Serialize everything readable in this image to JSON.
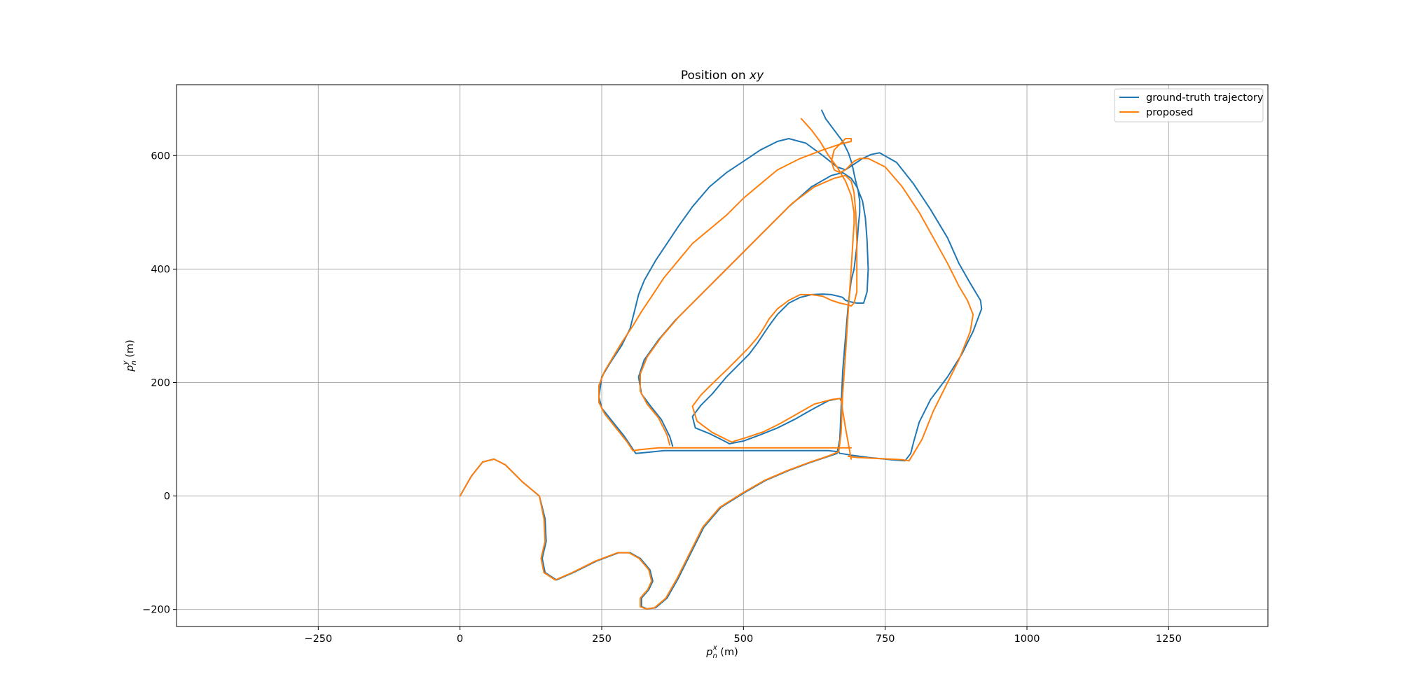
{
  "chart_data": {
    "type": "line",
    "title_prefix": "Position on ",
    "title_var": "xy",
    "xlabel_var": "p",
    "xlabel_sub": "n",
    "xlabel_sup": "x",
    "xlabel_unit": " (m)",
    "ylabel_var": "p",
    "ylabel_sub": "n",
    "ylabel_sup": "y",
    "ylabel_unit": " (m)",
    "xlim": [
      -500,
      1425
    ],
    "ylim": [
      -230,
      725
    ],
    "xticks": [
      -250,
      0,
      250,
      500,
      750,
      1000,
      1250
    ],
    "xtick_labels": [
      "−250",
      "0",
      "250",
      "500",
      "750",
      "1000",
      "1250"
    ],
    "yticks": [
      -200,
      0,
      200,
      400,
      600
    ],
    "ytick_labels": [
      "−200",
      "0",
      "200",
      "400",
      "600"
    ],
    "grid": true,
    "legend_position": "top-right",
    "series": [
      {
        "name": "ground-truth trajectory",
        "color": "#1f77b4",
        "x": [
          0,
          20,
          40,
          60,
          80,
          110,
          140,
          150,
          152,
          145,
          150,
          170,
          200,
          240,
          280,
          300,
          318,
          335,
          340,
          333,
          320,
          320,
          330,
          345,
          365,
          385,
          410,
          430,
          460,
          500,
          540,
          580,
          620,
          650,
          665,
          670,
          672,
          675,
          680,
          685,
          690,
          695,
          700,
          703,
          705,
          705,
          702,
          698,
          695,
          693,
          690,
          685,
          675,
          660,
          645,
          638,
          638
        ],
        "y": [
          0,
          35,
          60,
          65,
          55,
          25,
          0,
          -40,
          -80,
          -110,
          -135,
          -148,
          -135,
          -115,
          -100,
          -100,
          -110,
          -130,
          -150,
          -165,
          -180,
          -195,
          -199,
          -197,
          -180,
          -145,
          -95,
          -55,
          -20,
          5,
          28,
          45,
          60,
          70,
          75,
          100,
          150,
          220,
          280,
          340,
          380,
          400,
          440,
          480,
          500,
          520,
          540,
          555,
          568,
          578,
          590,
          605,
          625,
          645,
          665,
          680,
          680
        ]
      },
      {
        "name": "",
        "color": "#1f77b4",
        "x": [
          672,
          690,
          720,
          760,
          785,
          795,
          800,
          810,
          830,
          860,
          885,
          905,
          920,
          918,
          900,
          880,
          860,
          830,
          800,
          770,
          740,
          725,
          710,
          695,
          680,
          665,
          640,
          610,
          580,
          560,
          530,
          500,
          470,
          440,
          410,
          385,
          365,
          345,
          325,
          315,
          310,
          300,
          285,
          265,
          250,
          245,
          250,
          270,
          290,
          300,
          310,
          330,
          360,
          390,
          420,
          460,
          500,
          540,
          580,
          620,
          650,
          668,
          670
        ],
        "y": [
          75,
          72,
          68,
          64,
          62,
          75,
          95,
          130,
          170,
          210,
          250,
          290,
          330,
          345,
          375,
          410,
          455,
          505,
          550,
          588,
          605,
          602,
          595,
          585,
          575,
          580,
          600,
          622,
          630,
          625,
          610,
          590,
          570,
          545,
          510,
          475,
          445,
          415,
          380,
          355,
          335,
          295,
          265,
          235,
          210,
          175,
          155,
          130,
          105,
          90,
          75,
          77,
          80,
          80,
          80,
          80,
          80,
          80,
          80,
          80,
          80,
          78,
          75
        ]
      },
      {
        "name": "",
        "color": "#1f77b4",
        "x": [
          375,
          370,
          355,
          335,
          320,
          315,
          325,
          350,
          380,
          420,
          460,
          500,
          540,
          580,
          620,
          655,
          675,
          690,
          700,
          710,
          715,
          718,
          720,
          718,
          712,
          700,
          690,
          680,
          675,
          668,
          655,
          640,
          620,
          600,
          580,
          560,
          545,
          535,
          525,
          510,
          490,
          470,
          445,
          425,
          410,
          415,
          440,
          460,
          470,
          475,
          480,
          500,
          530,
          560,
          590,
          620,
          650,
          670,
          672
        ],
        "y": [
          88,
          105,
          135,
          160,
          180,
          210,
          240,
          275,
          310,
          350,
          390,
          430,
          470,
          510,
          545,
          565,
          570,
          560,
          545,
          520,
          490,
          450,
          400,
          360,
          340,
          340,
          342,
          345,
          350,
          352,
          355,
          356,
          355,
          350,
          340,
          320,
          300,
          285,
          270,
          250,
          230,
          210,
          180,
          160,
          140,
          120,
          110,
          100,
          95,
          92,
          93,
          97,
          108,
          120,
          135,
          152,
          168,
          172,
          168
        ]
      },
      {
        "name": "proposed",
        "color": "#ff7f0e",
        "x": [
          0,
          20,
          40,
          60,
          80,
          110,
          140,
          148,
          150,
          143,
          148,
          168,
          198,
          238,
          278,
          298,
          316,
          333,
          338,
          331,
          318,
          318,
          328,
          343,
          363,
          383,
          408,
          428,
          458,
          498,
          538,
          578,
          618,
          648,
          668,
          672,
          675,
          680,
          685,
          690,
          693,
          695,
          695,
          690,
          680,
          665,
          650,
          635,
          620,
          602,
          602
        ],
        "y": [
          0,
          35,
          60,
          65,
          55,
          25,
          0,
          -40,
          -80,
          -110,
          -135,
          -148,
          -135,
          -115,
          -100,
          -100,
          -110,
          -130,
          -150,
          -165,
          -180,
          -195,
          -199,
          -197,
          -180,
          -145,
          -95,
          -55,
          -20,
          5,
          28,
          45,
          60,
          70,
          78,
          110,
          180,
          250,
          330,
          400,
          450,
          480,
          500,
          530,
          555,
          580,
          600,
          625,
          645,
          665,
          665
        ]
      },
      {
        "name": "",
        "color": "#ff7f0e",
        "x": [
          685,
          700,
          740,
          780,
          792,
          800,
          815,
          835,
          860,
          880,
          900,
          905,
          895,
          880,
          860,
          835,
          810,
          780,
          750,
          720,
          705,
          695,
          690,
          680,
          670,
          660,
          655,
          660,
          680,
          690,
          690,
          670,
          640,
          600,
          560,
          530,
          500,
          470,
          440,
          410,
          385,
          360,
          340,
          320,
          305,
          295,
          285,
          270,
          255,
          245,
          245,
          255,
          275,
          295,
          305,
          320,
          350,
          380,
          420,
          470,
          520,
          570,
          620,
          665,
          680,
          685,
          690,
          680,
          670,
          668
        ],
        "y": [
          70,
          68,
          66,
          64,
          62,
          75,
          100,
          150,
          200,
          240,
          290,
          320,
          345,
          370,
          410,
          455,
          500,
          545,
          580,
          595,
          595,
          590,
          585,
          575,
          570,
          575,
          590,
          610,
          630,
          630,
          625,
          620,
          610,
          595,
          575,
          550,
          525,
          495,
          470,
          445,
          415,
          385,
          355,
          325,
          300,
          285,
          270,
          245,
          220,
          195,
          165,
          145,
          120,
          95,
          80,
          82,
          85,
          85,
          85,
          85,
          85,
          85,
          85,
          85,
          85,
          85,
          85,
          85,
          85,
          85
        ]
      },
      {
        "name": "",
        "color": "#ff7f0e",
        "x": [
          370,
          365,
          350,
          330,
          318,
          318,
          330,
          355,
          385,
          425,
          465,
          505,
          545,
          585,
          625,
          660,
          680,
          690,
          695,
          698,
          700,
          700,
          700,
          695,
          690,
          680,
          670,
          655,
          640,
          620,
          600,
          580,
          560,
          545,
          535,
          525,
          510,
          490,
          470,
          445,
          425,
          410,
          418,
          445,
          465,
          475,
          480,
          485,
          505,
          535,
          565,
          595,
          625,
          655,
          672,
          675,
          680,
          690
        ],
        "y": [
          90,
          108,
          138,
          162,
          185,
          215,
          245,
          280,
          315,
          355,
          395,
          435,
          475,
          515,
          545,
          560,
          565,
          555,
          535,
          500,
          450,
          400,
          360,
          340,
          335,
          338,
          340,
          345,
          352,
          355,
          355,
          345,
          330,
          312,
          295,
          280,
          262,
          242,
          222,
          198,
          178,
          158,
          132,
          112,
          102,
          97,
          95,
          97,
          103,
          113,
          128,
          145,
          162,
          170,
          172,
          150,
          120,
          65
        ]
      }
    ]
  }
}
